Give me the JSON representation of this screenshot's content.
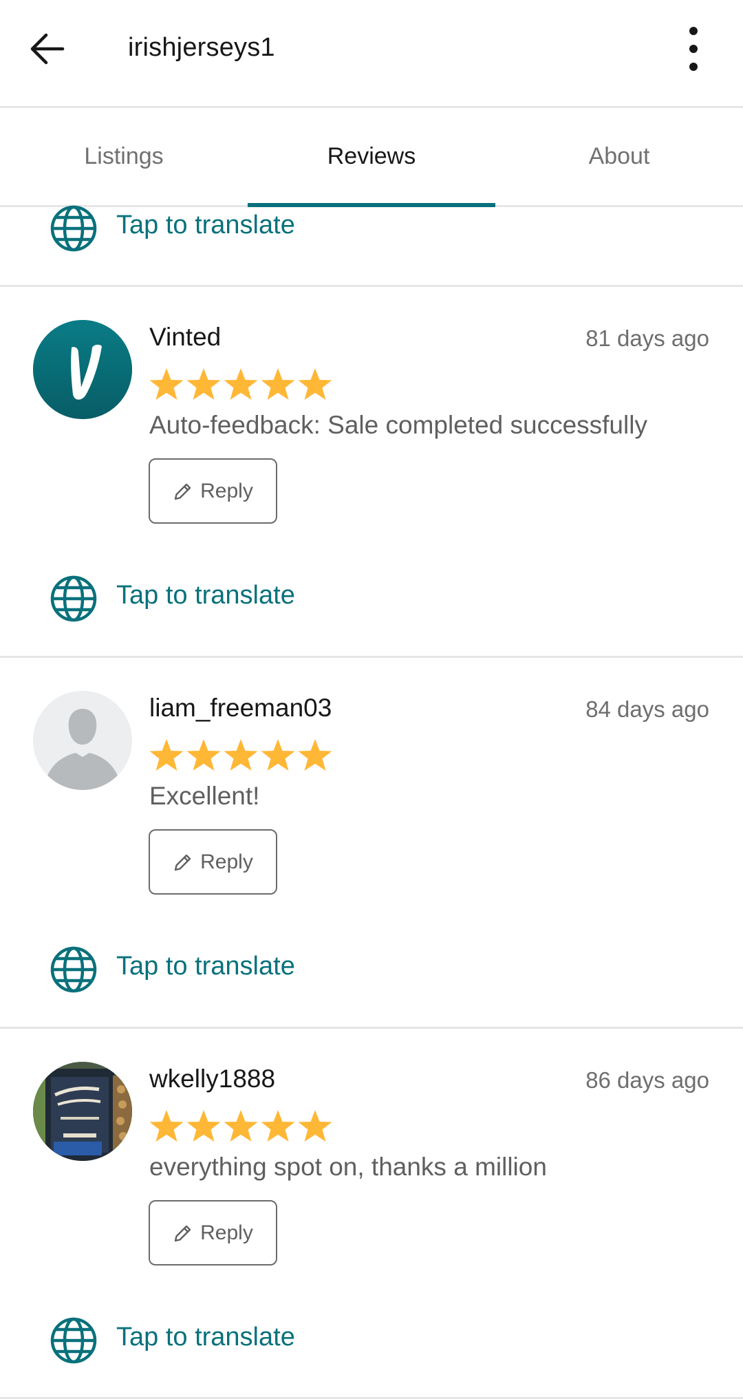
{
  "header": {
    "title": "irishjerseys1"
  },
  "tabs": [
    {
      "label": "Listings",
      "active": false
    },
    {
      "label": "Reviews",
      "active": true
    },
    {
      "label": "About",
      "active": false
    }
  ],
  "translate_label": "Tap to translate",
  "reviews": [
    {
      "name": "Vinted",
      "date": "81 days ago",
      "rating": 5,
      "text": "Auto-feedback: Sale completed successfully",
      "reply_label": "Reply",
      "avatar": "vinted-logo"
    },
    {
      "name": "liam_freeman03",
      "date": "84 days ago",
      "rating": 5,
      "text": "Excellent!",
      "reply_label": "Reply",
      "avatar": "default-user"
    },
    {
      "name": "wkelly1888",
      "date": "86 days ago",
      "rating": 5,
      "text": "everything spot on, thanks a million",
      "reply_label": "Reply",
      "avatar": "user-photo"
    }
  ],
  "colors": {
    "accent": "#09717b",
    "star": "#ffb736",
    "divider": "#e6e6e6"
  }
}
